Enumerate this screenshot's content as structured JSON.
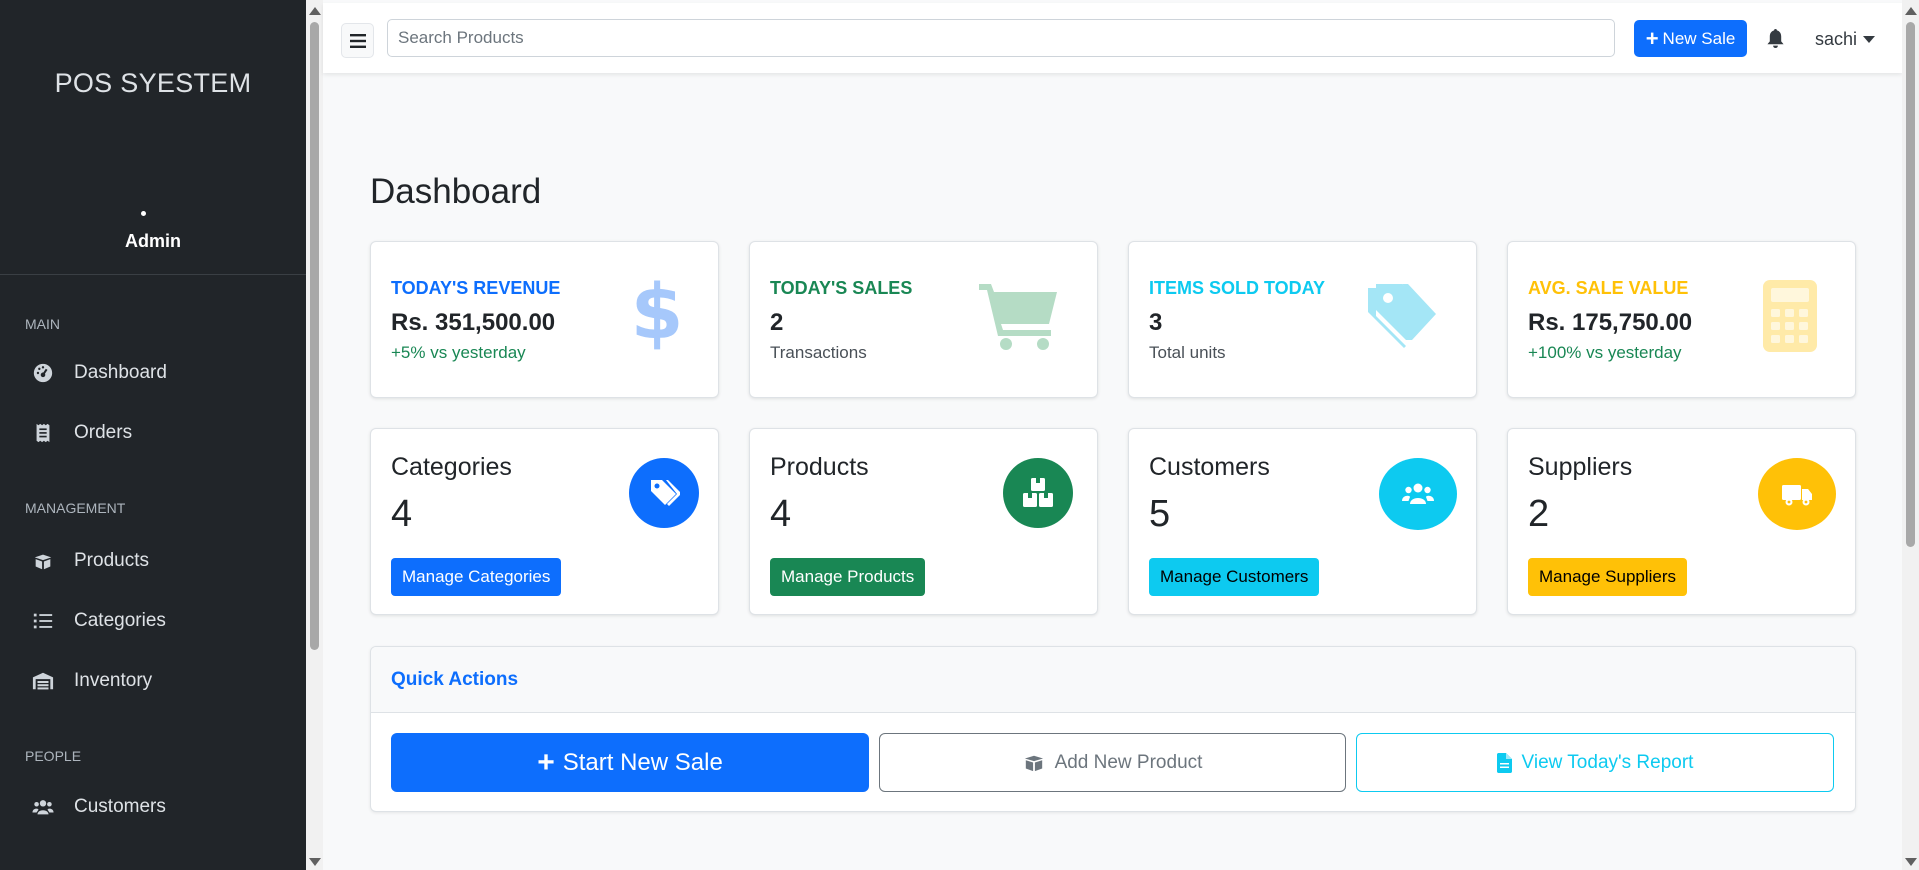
{
  "sidebar": {
    "brand": "POS SYESTEM",
    "user": "Admin",
    "sections": [
      {
        "heading": "MAIN",
        "items": [
          "Dashboard",
          "Orders"
        ]
      },
      {
        "heading": "MANAGEMENT",
        "items": [
          "Products",
          "Categories",
          "Inventory"
        ]
      },
      {
        "heading": "PEOPLE",
        "items": [
          "Customers"
        ]
      }
    ]
  },
  "topbar": {
    "search_placeholder": "Search Products",
    "new_sale_label": "New Sale",
    "username": "sachi"
  },
  "page_title": "Dashboard",
  "stats": [
    {
      "label": "TODAY'S REVENUE",
      "value": "Rs. 351,500.00",
      "sub": "+5% vs yesterday",
      "color": "#0d6efd",
      "sub_color": "#198754",
      "icon": "dollar-icon"
    },
    {
      "label": "TODAY'S SALES",
      "value": "2",
      "sub": "Transactions",
      "color": "#198754",
      "sub_color": "#495057",
      "icon": "cart-icon"
    },
    {
      "label": "ITEMS SOLD TODAY",
      "value": "3",
      "sub": "Total units",
      "color": "#0dcaf0",
      "sub_color": "#495057",
      "icon": "tags-icon"
    },
    {
      "label": "AVG. SALE VALUE",
      "value": "Rs. 175,750.00",
      "sub": "+100% vs yesterday",
      "color": "#ffc107",
      "sub_color": "#198754",
      "icon": "calculator-icon"
    }
  ],
  "management": [
    {
      "title": "Categories",
      "count": "4",
      "button": "Manage Categories",
      "color": "#0d6efd",
      "icon": "tags-icon"
    },
    {
      "title": "Products",
      "count": "4",
      "button": "Manage Products",
      "color": "#198754",
      "icon": "boxes-icon"
    },
    {
      "title": "Customers",
      "count": "5",
      "button": "Manage Customers",
      "color": "#0dcaf0",
      "icon": "users-icon"
    },
    {
      "title": "Suppliers",
      "count": "2",
      "button": "Manage Suppliers",
      "color": "#ffc107",
      "icon": "truck-icon"
    }
  ],
  "quick_actions": {
    "title": "Quick Actions",
    "start_sale": "Start New Sale",
    "add_product": "Add New Product",
    "view_report": "View Today's Report"
  }
}
